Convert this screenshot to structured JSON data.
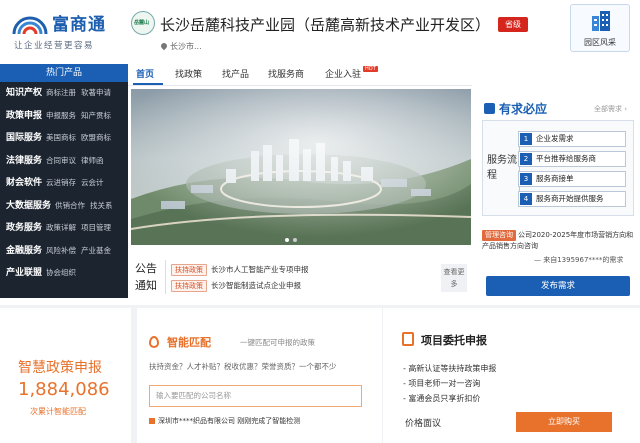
{
  "header": {
    "logo_text": "富商通",
    "logo_slogan": "让企业经营更容易",
    "park_badge_text": "岳麓山",
    "park_title": "长沙岳麓科技产业园（岳麓高新技术产业开发区）",
    "province_tag": "省级",
    "location": "长沙市...",
    "scenery_label": "园区风采"
  },
  "sidebar": {
    "heading": "热门产品",
    "categories": [
      {
        "main": "知识产权",
        "subs": [
          "商标注册",
          "软著申请"
        ]
      },
      {
        "main": "政策申报",
        "subs": [
          "申报服务",
          "知产贯标"
        ]
      },
      {
        "main": "国际服务",
        "subs": [
          "美国商标",
          "欧盟商标"
        ]
      },
      {
        "main": "法律服务",
        "subs": [
          "合同审议",
          "律师函"
        ]
      },
      {
        "main": "财会软件",
        "subs": [
          "云进销存",
          "云会计"
        ]
      },
      {
        "main": "大数据服务",
        "subs": [
          "供销合作",
          "找关系"
        ]
      },
      {
        "main": "政务服务",
        "subs": [
          "政策详解",
          "项目管理"
        ]
      },
      {
        "main": "金融服务",
        "subs": [
          "风险补偿",
          "产业基金"
        ]
      },
      {
        "main": "产业联盟",
        "subs": [
          "协会组织"
        ]
      }
    ]
  },
  "nav": {
    "items": [
      "首页",
      "找政策",
      "找产品",
      "找服务商",
      "企业入驻"
    ],
    "hot_badge": "HOT"
  },
  "notice": {
    "title": "公告通知",
    "rows": [
      {
        "tag": "扶持政策",
        "text": "长沙市人工智能产业专项申报"
      },
      {
        "tag": "扶持政策",
        "text": "长沙智能制造试点企业申报"
      }
    ],
    "more": "查看更多"
  },
  "request": {
    "title": "有求必应",
    "all_link": "全部需求 ›",
    "flow_label": "服务流程",
    "steps": [
      {
        "num": "1",
        "text": "企业发需求"
      },
      {
        "num": "2",
        "text": "平台推荐给服务商"
      },
      {
        "num": "3",
        "text": "服务商接单"
      },
      {
        "num": "4",
        "text": "服务商开始提供服务"
      }
    ],
    "consult_tag": "管理咨询",
    "consult_text": "公司2020-2025年度市场营销方向和产品销售方向咨询",
    "consult_from": "— 来自1395967****的需求",
    "publish_btn": "发布需求"
  },
  "policy": {
    "title": "智慧政策申报",
    "count": "1,884,086",
    "sub": "次累计智能匹配"
  },
  "match": {
    "title": "智能匹配",
    "tagline": "一键匹配可申报的政策",
    "question": "扶持资金？人才补贴？税收优惠？荣誉资质？一个都不少",
    "input_placeholder": "输入要匹配的公司名称",
    "ticker": "深圳市****织品有限公司 刚刚完成了智能检测"
  },
  "entrust": {
    "title": "项目委托申报",
    "lines": [
      "- 高新认证等扶持政策申报",
      "- 项目老师一对一咨询",
      "- 富通会员只享折扣价"
    ],
    "price": "价格面议",
    "apply_btn": "立即购买"
  },
  "colors": {
    "brand_blue": "#1a5fb4",
    "accent_orange": "#e8722c",
    "sidebar_dark": "#1c2430",
    "alert_red": "#d5261d"
  }
}
